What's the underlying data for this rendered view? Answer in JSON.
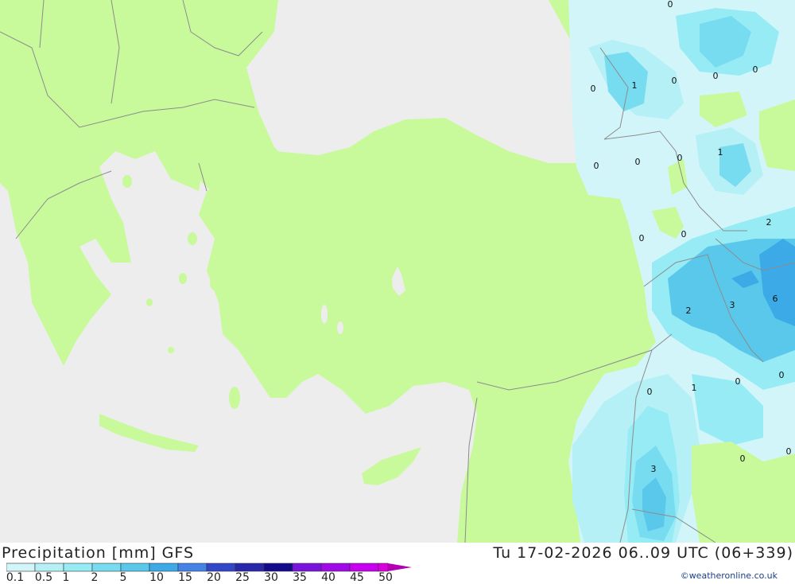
{
  "title": "Precipitation [mm] GFS",
  "valid_time": "Tu 17-02-2026 06..09 UTC (06+339)",
  "credit": "©weatheronline.co.uk",
  "legend": {
    "labels": [
      "0.1",
      "0.5",
      "1",
      "2",
      "5",
      "10",
      "15",
      "20",
      "25",
      "30",
      "35",
      "40",
      "45",
      "50"
    ],
    "colors": [
      "#d2f5fa",
      "#b4f0f5",
      "#96ebf5",
      "#78dcf0",
      "#5ac8eb",
      "#3caae6",
      "#4682e6",
      "#3246c8",
      "#2828aa",
      "#140a8c",
      "#7814dc",
      "#a00ae6",
      "#c800f0",
      "#dc00dc",
      "#b400b4"
    ]
  },
  "colors": {
    "land": "#c8fa9b",
    "sea": "#ededed",
    "border": "#8c8c8c"
  },
  "values": [
    "0",
    "1",
    "0",
    "0",
    "0",
    "0",
    "0",
    "0",
    "1",
    "2",
    "0",
    "0",
    "2",
    "3",
    "6",
    "0",
    "1",
    "0",
    "0",
    "0",
    "3",
    "0",
    "0"
  ]
}
